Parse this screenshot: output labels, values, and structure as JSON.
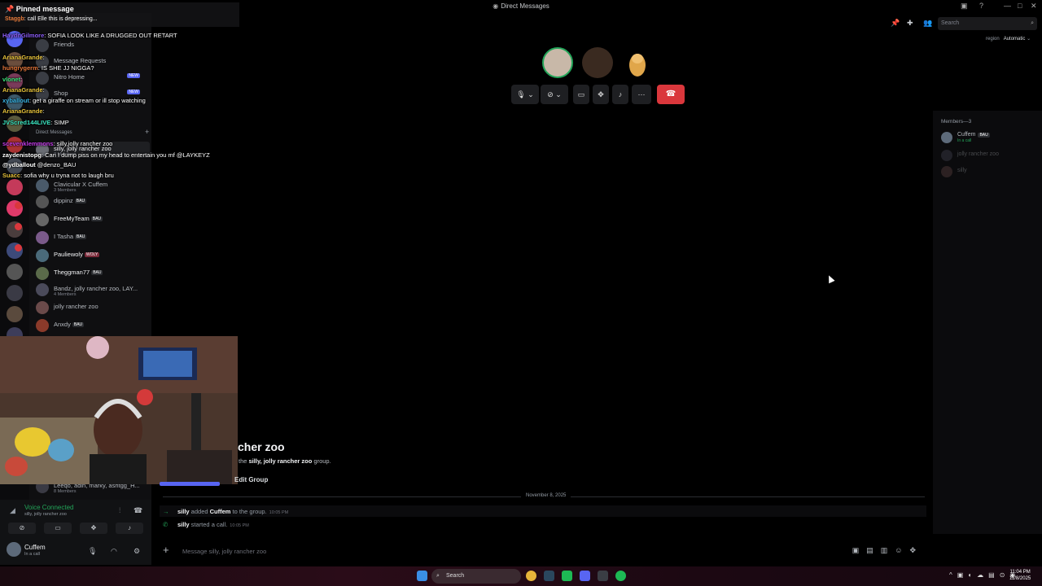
{
  "window": {
    "title": "Direct Messages"
  },
  "chat_overlay": {
    "pinned_header": "Pinned message",
    "pinned_user": "Staggb",
    "pinned_text": ": call Elle this is depressing...",
    "messages": [
      {
        "user": "HaydnGilmore",
        "text": ": SOFIA LOOK LIKE A DRUGGED OUT RETART",
        "color": "#8b5cf6"
      },
      {
        "user": "ArianaGrande",
        "text": ":",
        "color": "#e5c13a"
      },
      {
        "user": "hungrygerm",
        "text": ": IS SHE JJ NIGGA?",
        "color": "#e5763a"
      },
      {
        "user": "vlonet",
        "text": ":",
        "color": "#3ae57a"
      },
      {
        "user": "ArianaGrande",
        "text": ":",
        "color": "#e5c13a"
      },
      {
        "user": "xyballout",
        "text": ": get a giraffe on stream or ill stop watching",
        "color": "#3ab5e5"
      },
      {
        "user": "ArianaGrande",
        "text": ":",
        "color": "#e5c13a"
      },
      {
        "user": "JVScred144LIVE",
        "text": ": SIMP",
        "color": "#3ae5c1"
      },
      {
        "user": "scevenklemmons",
        "text": ": silly,jolly rancher zoo",
        "color": "#c13ae5"
      },
      {
        "user": "zaydenistopg",
        "text": ": Can I dump piss on my head to entertain you mf @LAYKEYZ",
        "color": "#ffffff"
      },
      {
        "user": "@ydballout",
        "text": " @denzo_BAU",
        "color": "#ffffff"
      },
      {
        "user": "Suacc",
        "text": ": sofia why u tryna not to laugh bru",
        "color": "#e5c13a"
      }
    ]
  },
  "sidebar": {
    "direct_messages_label": "Direct Messages",
    "items": [
      {
        "name": "Friends",
        "sub": "",
        "tag": ""
      },
      {
        "name": "Message Requests",
        "sub": "",
        "tag": ""
      },
      {
        "name": "Nitro Home",
        "sub": "",
        "tag": "NEW"
      },
      {
        "name": "Shop",
        "sub": "",
        "tag": "NEW"
      },
      {
        "name": "silly, jolly rancher zoo",
        "sub": "3 Members",
        "tag": ""
      },
      {
        "name": "Clavicular X Cuffem",
        "sub": "3 Members",
        "tag": ""
      },
      {
        "name": "dippinz",
        "sub": "",
        "tag": "BAU"
      },
      {
        "name": "FreeMyTeam",
        "sub": "",
        "tag": "BAU"
      },
      {
        "name": "I Tasha",
        "sub": "",
        "tag": "BAU"
      },
      {
        "name": "Pauliewoly",
        "sub": "",
        "tag": "WOLY"
      },
      {
        "name": "Theggman77",
        "sub": "",
        "tag": "BAU"
      },
      {
        "name": "Bandz, jolly rancher zoo, LAY...",
        "sub": "4 Members",
        "tag": ""
      },
      {
        "name": "jolly rancher zoo",
        "sub": "",
        "tag": ""
      },
      {
        "name": "Anxdy",
        "sub": "",
        "tag": "BAU"
      },
      {
        "name": "Leeqo, adin, marky, ashtgg_H...",
        "sub": "8 Members",
        "tag": ""
      }
    ],
    "new_badge": "NEW"
  },
  "voice_panel": {
    "status": "Voice Connected",
    "channel": "silly, jolly rancher zoo",
    "user_name": "Cuffem",
    "user_status": "In a call"
  },
  "call": {
    "hangup_icon": "phone-hangup-icon"
  },
  "toolbar": {
    "search_placeholder": "Search",
    "region_label": "region",
    "region_value": "Automatic"
  },
  "channel": {
    "title": "cher zoo",
    "subtitle_prefix": "the ",
    "subtitle_name": "silly, jolly rancher zoo",
    "subtitle_suffix": " group.",
    "edit_group": "Edit Group",
    "date_divider": "November 8, 2025",
    "sys1_user": "silly",
    "sys1_mid": " added ",
    "sys1_target": "Cuffem",
    "sys1_end": " to the group.",
    "sys1_time": "10:05 PM",
    "sys2_user": "silly",
    "sys2_end": " started a call.",
    "sys2_time": "10:05 PM",
    "input_placeholder": "Message silly, jolly rancher zoo"
  },
  "members": {
    "header": "Members—3",
    "list": [
      {
        "name": "Cuffem",
        "tag": "BAU",
        "status": "In a call"
      },
      {
        "name": "jolly rancher zoo",
        "tag": "",
        "status": ""
      },
      {
        "name": "silly",
        "tag": "",
        "status": ""
      }
    ]
  },
  "taskbar": {
    "search": "Search",
    "time": "11:04 PM",
    "date": "11/8/2025"
  }
}
